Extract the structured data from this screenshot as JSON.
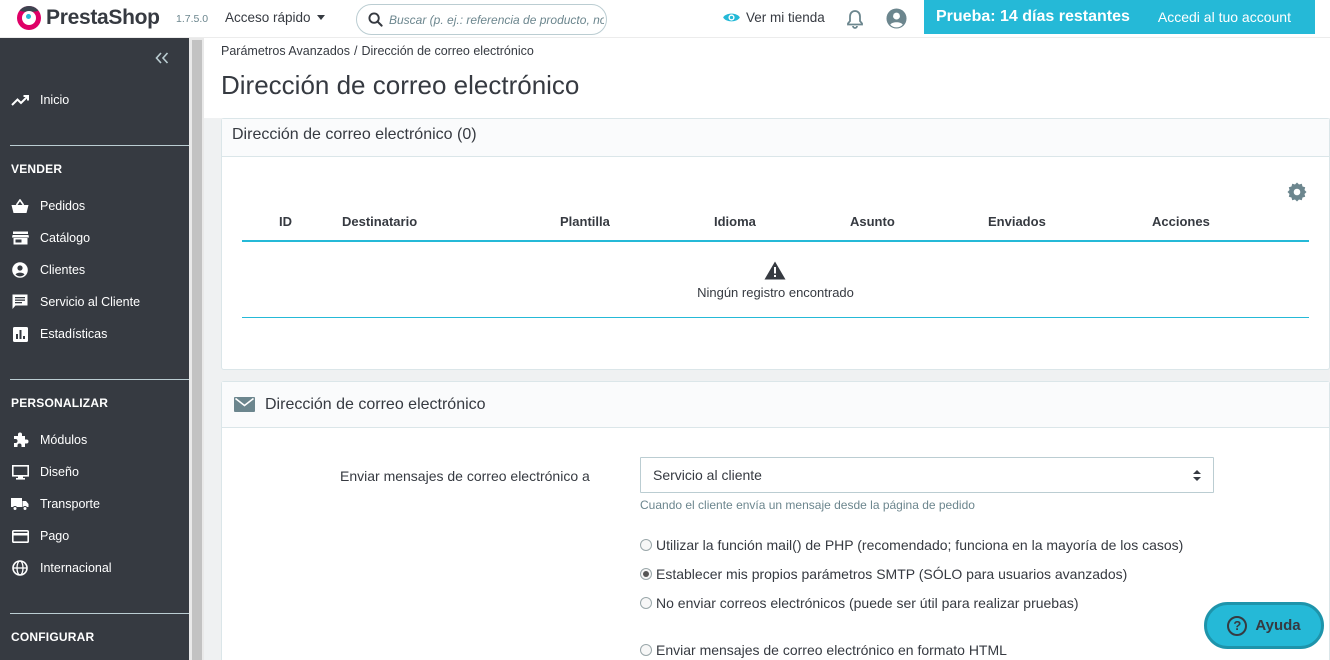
{
  "header": {
    "brand": "PrestaShop",
    "version": "1.7.5.0",
    "quick_access": "Acceso rápido",
    "search_placeholder": "Buscar (p. ej.: referencia de producto, no",
    "view_shop": "Ver mi tienda",
    "trial_title": "Prueba: 14 días restantes",
    "trial_link": "Accedi al tuo account"
  },
  "sidebar": {
    "home": "Inicio",
    "sections": [
      {
        "title": "VENDER",
        "items": [
          "Pedidos",
          "Catálogo",
          "Clientes",
          "Servicio al Cliente",
          "Estadísticas"
        ]
      },
      {
        "title": "PERSONALIZAR",
        "items": [
          "Módulos",
          "Diseño",
          "Transporte",
          "Pago",
          "Internacional"
        ]
      },
      {
        "title": "CONFIGURAR",
        "items": []
      }
    ]
  },
  "breadcrumb": [
    "Parámetros Avanzados",
    "Dirección de correo electrónico"
  ],
  "page_title": "Dirección de correo electrónico",
  "list_panel": {
    "title": "Dirección de correo electrónico (0)",
    "columns": [
      "ID",
      "Destinatario",
      "Plantilla",
      "Idioma",
      "Asunto",
      "Enviados",
      "Acciones"
    ],
    "empty_text": "Ningún registro encontrado"
  },
  "settings_panel": {
    "title": "Dirección de correo electrónico",
    "send_to_label": "Enviar mensajes de correo electrónico a",
    "send_to_value": "Servicio al cliente",
    "send_to_help": "Cuando el cliente envía un mensaje desde la página de pedido",
    "mail_options": [
      {
        "label": "Utilizar la función mail() de PHP (recomendado; funciona en la mayoría de los casos)",
        "checked": false
      },
      {
        "label": "Establecer mis propios parámetros SMTP (SÓLO para usuarios avanzados)",
        "checked": true
      },
      {
        "label": "No enviar correos electrónicos (puede ser útil para realizar pruebas)",
        "checked": false
      }
    ],
    "format_option": {
      "label": "Enviar mensajes de correo electrónico en formato HTML",
      "checked": false
    }
  },
  "help_button": "Ayuda",
  "colors": {
    "accent": "#25b9d7",
    "sidebar": "#363a41",
    "text": "#363a41"
  }
}
